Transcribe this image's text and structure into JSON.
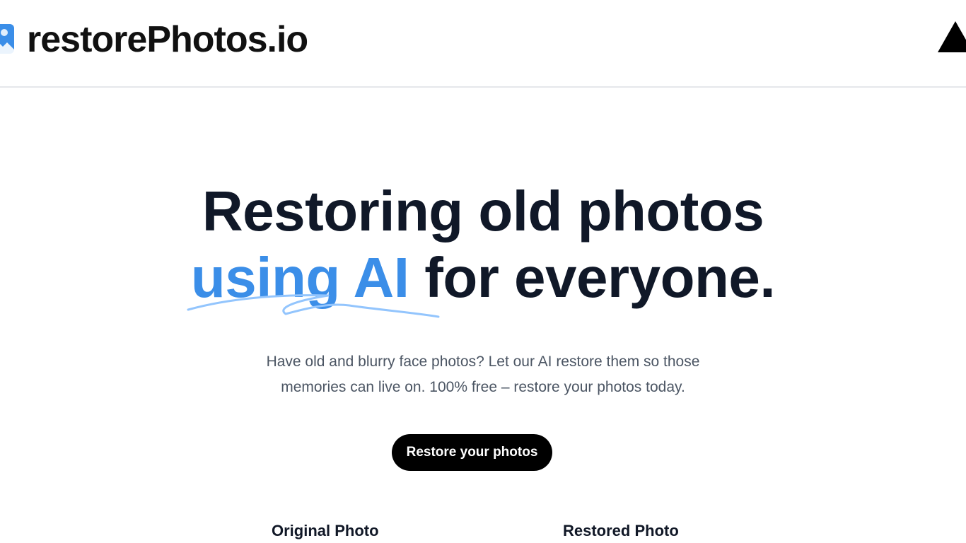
{
  "header": {
    "logo_text": "restorePhotos.io",
    "logo_icon": "image-icon",
    "github_icon": "vercel-triangle-icon"
  },
  "hero": {
    "title_line1": "Restoring old photos",
    "title_highlight": "using AI",
    "title_rest": "for everyone.",
    "subtitle_line1": "Have old and blurry face photos? Let our AI restore them so those",
    "subtitle_line2": "memories can live on. 100% free – restore your photos today.",
    "cta_label": "Restore your photos"
  },
  "comparison": {
    "original_label": "Original Photo",
    "restored_label": "Restored Photo"
  },
  "colors": {
    "accent": "#3b8ee8",
    "text_dark": "#101828",
    "button_bg": "#000000"
  }
}
